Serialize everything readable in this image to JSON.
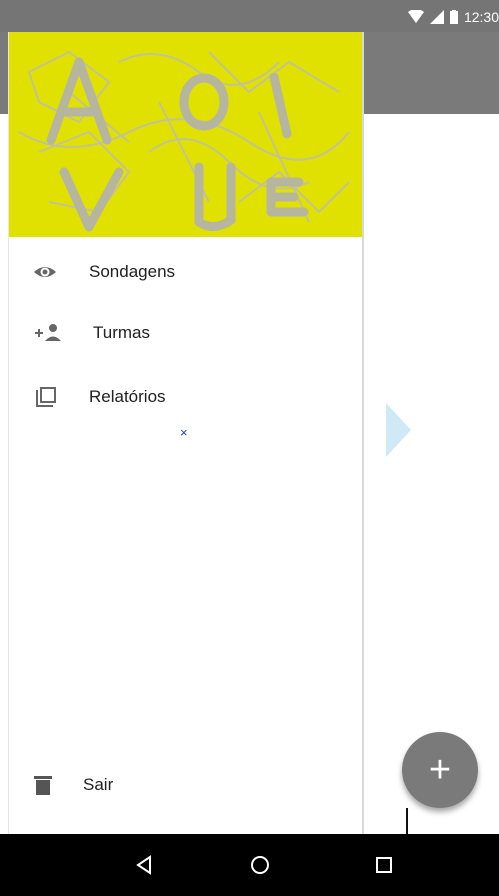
{
  "status_bar": {
    "time": "12:30"
  },
  "drawer": {
    "header_logo": "AOTVUEK",
    "items": [
      {
        "label": "Sondagens",
        "icon": "eye-icon"
      },
      {
        "label": "Turmas",
        "icon": "person-add-icon"
      },
      {
        "label": "Relatórios",
        "icon": "library-icon"
      }
    ],
    "x_mark": "×",
    "footer": {
      "label": "Sair",
      "icon": "trash-icon"
    }
  },
  "fab": {
    "label": "+",
    "icon": "plus-icon"
  },
  "nav_bar": {
    "back_icon": "back-icon",
    "home_icon": "home-icon",
    "recents_icon": "recents-icon"
  },
  "colors": {
    "header_yellow": "#e1e100",
    "app_bar": "#7a7a7a",
    "fab": "#7a7a7a",
    "arrow": "#cfe9f6"
  }
}
